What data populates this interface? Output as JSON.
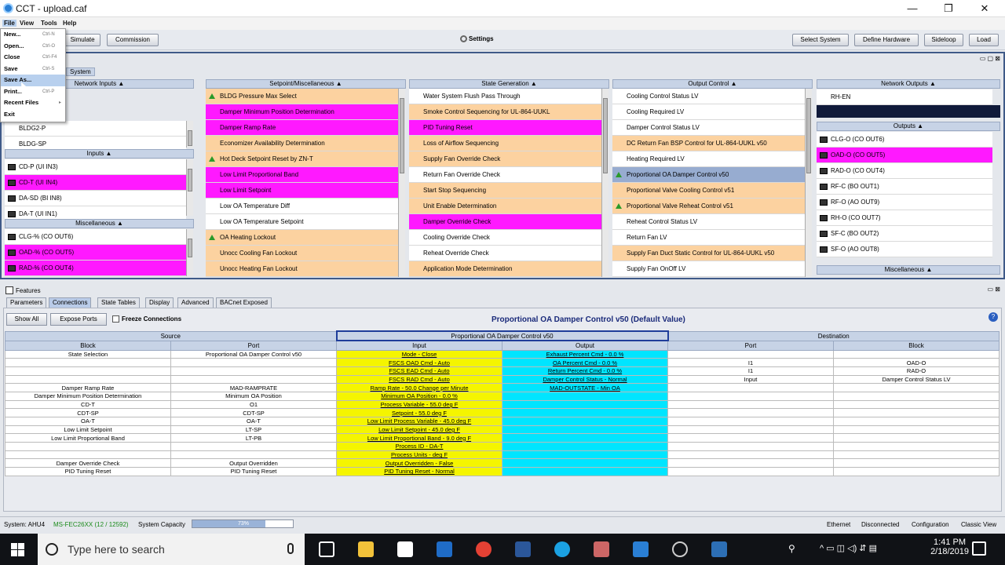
{
  "window": {
    "title": "CCT - upload.caf",
    "minimize": "—",
    "maximize": "❐",
    "close": "✕"
  },
  "menu": [
    "File",
    "View",
    "Tools",
    "Help"
  ],
  "file_menu": [
    {
      "label": "New...",
      "shortcut": "Ctrl-N"
    },
    {
      "label": "Open...",
      "shortcut": "Ctrl-O"
    },
    {
      "label": "Close",
      "shortcut": "Ctrl-F4"
    },
    {
      "label": "Save",
      "shortcut": "Ctrl-S"
    },
    {
      "label": "Save As...",
      "shortcut": ""
    },
    {
      "label": "Print...",
      "shortcut": "Ctrl-P"
    },
    {
      "label": "Recent Files",
      "shortcut": "▸"
    },
    {
      "label": "Exit",
      "shortcut": ""
    }
  ],
  "toolbar": {
    "simulate": "Simulate",
    "commission": "Commission",
    "settings": "Settings",
    "select_system": "Select System",
    "define_hardware": "Define Hardware",
    "sideloop": "Sideloop",
    "load": "Load"
  },
  "system_tab": "System",
  "panels": {
    "network_inputs": {
      "title": "Network Inputs ▲",
      "items": [
        {
          "label": "BLDG2-P",
          "color": "white"
        },
        {
          "label": "BLDG-SP",
          "color": "white"
        }
      ]
    },
    "inputs": {
      "title": "Inputs ▲",
      "items": [
        {
          "label": "CD-P (UI IN3)",
          "color": "white"
        },
        {
          "label": "CD-T (UI IN4)",
          "color": "magenta"
        },
        {
          "label": "DA-SD (BI IN8)",
          "color": "white"
        },
        {
          "label": "DA-T (UI IN1)",
          "color": "white"
        }
      ]
    },
    "misc_left": {
      "title": "Miscellaneous ▲",
      "items": [
        {
          "label": "CLG-% (CO OUT6)",
          "color": "white"
        },
        {
          "label": "OAD-% (CO OUT5)",
          "color": "magenta"
        },
        {
          "label": "RAD-% (CO OUT4)",
          "color": "magenta"
        }
      ]
    },
    "setpoint": {
      "title": "Setpoint/Miscellaneous ▲",
      "items": [
        {
          "label": "BLDG Pressure Max Select",
          "color": "orange",
          "mark": "tri"
        },
        {
          "label": "Damper Minimum Position Determination",
          "color": "magenta"
        },
        {
          "label": "Damper Ramp Rate",
          "color": "magenta"
        },
        {
          "label": "Economizer Availability Determination",
          "color": "orange"
        },
        {
          "label": "Hot Deck Setpoint Reset by ZN-T",
          "color": "orange",
          "mark": "tri"
        },
        {
          "label": "Low Limit Proportional Band",
          "color": "magenta"
        },
        {
          "label": "Low Limit Setpoint",
          "color": "magenta"
        },
        {
          "label": "Low OA Temperature Diff",
          "color": "white"
        },
        {
          "label": "Low OA Temperature Setpoint",
          "color": "white"
        },
        {
          "label": "OA Heating Lockout",
          "color": "orange",
          "mark": "tri"
        },
        {
          "label": "Unocc Cooling Fan Lockout",
          "color": "orange"
        },
        {
          "label": "Unocc Heating Fan Lockout",
          "color": "orange"
        }
      ]
    },
    "state_gen": {
      "title": "State Generation ▲",
      "items": [
        {
          "label": "Water System Flush Pass Through",
          "color": "white"
        },
        {
          "label": "Smoke Control Sequencing for UL-864-UUKL",
          "color": "orange"
        },
        {
          "label": "PID Tuning Reset",
          "color": "magenta"
        },
        {
          "label": "Loss of Airflow Sequencing",
          "color": "orange"
        },
        {
          "label": "Supply Fan Override Check",
          "color": "orange"
        },
        {
          "label": "Return Fan Override Check",
          "color": "white"
        },
        {
          "label": "Start Stop Sequencing",
          "color": "orange"
        },
        {
          "label": "Unit Enable Determination",
          "color": "orange"
        },
        {
          "label": "Damper Override Check",
          "color": "magenta"
        },
        {
          "label": "Cooling Override Check",
          "color": "white"
        },
        {
          "label": "Reheat Override Check",
          "color": "white"
        },
        {
          "label": "Application Mode Determination",
          "color": "orange"
        }
      ]
    },
    "output_control": {
      "title": "Output Control ▲",
      "items": [
        {
          "label": "Cooling Control Status LV",
          "color": "white"
        },
        {
          "label": "Cooling Required LV",
          "color": "white"
        },
        {
          "label": "Damper Control Status LV",
          "color": "white"
        },
        {
          "label": "DC Return Fan BSP Control for UL-864-UUKL v50",
          "color": "orange"
        },
        {
          "label": "Heating Required LV",
          "color": "white"
        },
        {
          "label": "Proportional OA Damper Control v50",
          "color": "blue",
          "mark": "tri"
        },
        {
          "label": "Proportional Valve Cooling Control v51",
          "color": "orange"
        },
        {
          "label": "Proportional Valve Reheat Control v51",
          "color": "orange",
          "mark": "tri"
        },
        {
          "label": "Reheat Control Status LV",
          "color": "white"
        },
        {
          "label": "Return Fan LV",
          "color": "white"
        },
        {
          "label": "Supply Fan Duct Static Control for UL-864-UUKL v50",
          "color": "orange"
        },
        {
          "label": "Supply Fan OnOff LV",
          "color": "white"
        }
      ]
    },
    "network_outputs": {
      "title": "Network Outputs ▲",
      "items": [
        {
          "label": "RH-EN",
          "color": "white"
        }
      ]
    },
    "outputs": {
      "title": "Outputs ▲",
      "items": [
        {
          "label": "CLG-O (CO OUT6)",
          "color": "white"
        },
        {
          "label": "OAD-O (CO OUT5)",
          "color": "magenta"
        },
        {
          "label": "RAD-O (CO OUT4)",
          "color": "white"
        },
        {
          "label": "RF-C (BO OUT1)",
          "color": "white"
        },
        {
          "label": "RF-O (AO OUT9)",
          "color": "white"
        },
        {
          "label": "RH-O (CO OUT7)",
          "color": "white"
        },
        {
          "label": "SF-C (BO OUT2)",
          "color": "white"
        },
        {
          "label": "SF-O (AO OUT8)",
          "color": "white"
        }
      ]
    },
    "misc_right": {
      "title": "Miscellaneous ▲"
    }
  },
  "features": {
    "title": "Features",
    "tabs": [
      "Parameters",
      "Connections",
      "State Tables",
      "Display",
      "Advanced",
      "BACnet Exposed"
    ],
    "show_all": "Show All",
    "expose_ports": "Expose Ports",
    "freeze": "Freeze Connections",
    "heading": "Proportional OA Damper Control v50 (Default Value)"
  },
  "connections": {
    "group_source": "Source",
    "group_mid": "Proportional OA Damper Control v50",
    "group_dest": "Destination",
    "col_block": "Block",
    "col_port": "Port",
    "col_input": "Input",
    "col_output": "Output",
    "col_dport": "Port",
    "col_dblock": "Block",
    "rows": [
      {
        "sb": "State Selection",
        "sp": "Proportional OA Damper Control v50",
        "in": "Mode - Close",
        "out": "Exhaust Percent Cmd - 0.0 %",
        "dp": "",
        "db": ""
      },
      {
        "sb": "",
        "sp": "",
        "in": "FSCS OAD Cmd - Auto",
        "out": "OA Percent Cmd - 0.0 %",
        "dp": "I1",
        "db": "OAD-O"
      },
      {
        "sb": "",
        "sp": "",
        "in": "FSCS EAD Cmd - Auto",
        "out": "Return Percent Cmd - 0.0 %",
        "dp": "I1",
        "db": "RAD-O"
      },
      {
        "sb": "",
        "sp": "",
        "in": "FSCS RAD Cmd - Auto",
        "out": "Damper Control Status - Normal",
        "dp": "Input",
        "db": "Damper Control Status LV"
      },
      {
        "sb": "Damper Ramp Rate",
        "sp": "MAD-RAMPRATE",
        "in": "Ramp Rate - 50.0 Change per Minute",
        "out": "MAD-OUTSTATE - Min OA",
        "dp": "",
        "db": ""
      },
      {
        "sb": "Damper Minimum Position Determination",
        "sp": "Minimum OA Position",
        "in": "Minimum OA Position - 0.0 %",
        "out": "",
        "dp": "",
        "db": ""
      },
      {
        "sb": "CD-T",
        "sp": "O1",
        "in": "Process Variable - 55.0 deg F",
        "out": "",
        "dp": "",
        "db": ""
      },
      {
        "sb": "CDT-SP",
        "sp": "CDT-SP",
        "in": "Setpoint - 55.0 deg F",
        "out": "",
        "dp": "",
        "db": ""
      },
      {
        "sb": "OA-T",
        "sp": "OA-T",
        "in": "Low Limit Process Variable - 45.0 deg F",
        "out": "",
        "dp": "",
        "db": ""
      },
      {
        "sb": "Low Limit Setpoint",
        "sp": "LT-SP",
        "in": "Low Limit Setpoint - 45.0 deg F",
        "out": "",
        "dp": "",
        "db": ""
      },
      {
        "sb": "Low Limit Proportional Band",
        "sp": "LT-PB",
        "in": "Low Limit Proportional Band - 9.0 deg F",
        "out": "",
        "dp": "",
        "db": ""
      },
      {
        "sb": "",
        "sp": "",
        "in": "Process ID - DA-T",
        "out": "",
        "dp": "",
        "db": ""
      },
      {
        "sb": "",
        "sp": "",
        "in": "Process Units - deg F",
        "out": "",
        "dp": "",
        "db": ""
      },
      {
        "sb": "Damper Override Check",
        "sp": "Output Overridden",
        "in": "Output Overridden - False",
        "out": "",
        "dp": "",
        "db": ""
      },
      {
        "sb": "PID Tuning Reset",
        "sp": "PID Tuning Reset",
        "in": "PID Tuning Reset - Normal",
        "out": "",
        "dp": "",
        "db": ""
      }
    ]
  },
  "status": {
    "system": "System: AHU4",
    "controller": "MS-FEC26XX (12 / 12592)",
    "capacity_label": "System Capacity",
    "capacity_text": "73%",
    "capacity_value": 0.73,
    "ethernet": "Ethernet",
    "disconnected": "Disconnected",
    "configuration": "Configuration",
    "classic": "Classic View"
  },
  "taskbar": {
    "search": "Type here to search",
    "time": "1:41 PM",
    "date": "2/18/2019"
  }
}
